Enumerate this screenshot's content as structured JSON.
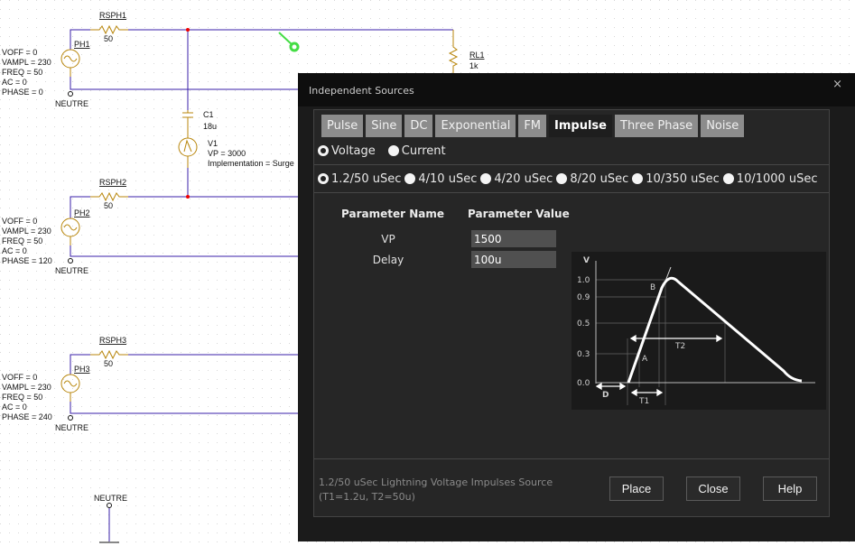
{
  "schematic": {
    "phases": [
      {
        "res_name": "RSPH1",
        "res_value": "50",
        "src_name": "PH1",
        "params": [
          "VOFF = 0",
          "VAMPL = 230",
          "FREQ = 50",
          "AC = 0",
          "PHASE = 0"
        ],
        "ground": "NEUTRE"
      },
      {
        "res_name": "RSPH2",
        "res_value": "50",
        "src_name": "PH2",
        "params": [
          "VOFF = 0",
          "VAMPL = 230",
          "FREQ = 50",
          "AC = 0",
          "PHASE = 120"
        ],
        "ground": "NEUTRE"
      },
      {
        "res_name": "RSPH3",
        "res_value": "50",
        "src_name": "PH3",
        "params": [
          "VOFF = 0",
          "VAMPL = 230",
          "FREQ = 50",
          "AC = 0",
          "PHASE = 240"
        ],
        "ground": "NEUTRE"
      }
    ],
    "cap": {
      "name": "C1",
      "value": "18u"
    },
    "surge": {
      "name": "V1",
      "vp": "VP = 3000",
      "impl": "Implementation = Surge"
    },
    "load": {
      "name": "RL1",
      "value": "1k"
    },
    "ground_label": "NEUTRE",
    "wire_color": "#3a1fa8",
    "part_color": "#b8860b"
  },
  "dialog": {
    "title": "Independent Sources",
    "close_glyph": "×",
    "tabs": [
      "Pulse",
      "Sine",
      "DC",
      "Exponential",
      "FM",
      "Impulse",
      "Three Phase",
      "Noise"
    ],
    "active_tab": "Impulse",
    "source_types": [
      {
        "label": "Voltage",
        "selected": true
      },
      {
        "label": "Current",
        "selected": false
      }
    ],
    "waveforms": [
      {
        "label": "1.2/50 uSec",
        "selected": true
      },
      {
        "label": "4/10 uSec",
        "selected": false
      },
      {
        "label": "4/20 uSec",
        "selected": false
      },
      {
        "label": "8/20 uSec",
        "selected": false
      },
      {
        "label": "10/350 uSec",
        "selected": false
      },
      {
        "label": "10/1000 uSec",
        "selected": false
      }
    ],
    "param_header_name": "Parameter Name",
    "param_header_value": "Parameter Value",
    "params": [
      {
        "name": "VP",
        "value": "1500"
      },
      {
        "name": "Delay",
        "value": "100u"
      }
    ],
    "graph": {
      "ylabel": "V",
      "ticks": [
        "1.0",
        "0.9",
        "0.5",
        "0.3",
        "0.0"
      ],
      "labels": {
        "A": "A",
        "B": "B",
        "T1": "T1",
        "T2": "T2",
        "D": "D"
      }
    },
    "description": [
      "1.2/50 uSec Lightning Voltage Impulses Source",
      "(T1=1.2u, T2=50u)"
    ],
    "buttons": {
      "place": "Place",
      "close": "Close",
      "help": "Help"
    }
  }
}
